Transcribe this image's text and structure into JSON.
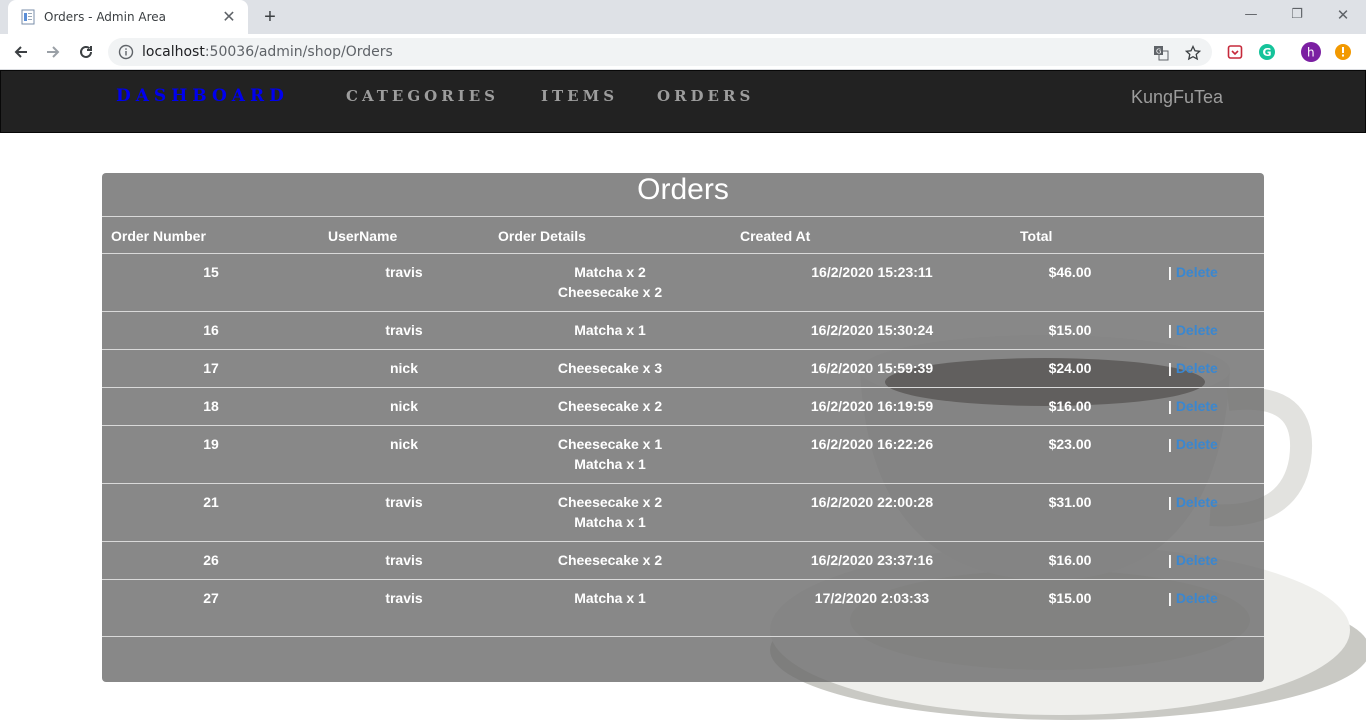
{
  "browser": {
    "tab_title": "Orders - Admin Area",
    "url_host": "localhost",
    "url_path": ":50036/admin/shop/Orders"
  },
  "nav": {
    "dashboard": "Dashboard",
    "categories": "Categories",
    "items": "Items",
    "orders": "Orders",
    "brand": "KungFuTea"
  },
  "panel": {
    "title": "Orders",
    "headers": {
      "order_number": "Order Number",
      "username": "UserName",
      "order_details": "Order Details",
      "created_at": "Created At",
      "total": "Total"
    },
    "delete_label": "Delete",
    "separator": "|",
    "rows": [
      {
        "num": "15",
        "user": "travis",
        "details": [
          "Matcha x 2",
          "Cheesecake x 2"
        ],
        "date": "16/2/2020 15:23:11",
        "total": "$46.00"
      },
      {
        "num": "16",
        "user": "travis",
        "details": [
          "Matcha x 1"
        ],
        "date": "16/2/2020 15:30:24",
        "total": "$15.00"
      },
      {
        "num": "17",
        "user": "nick",
        "details": [
          "Cheesecake x 3"
        ],
        "date": "16/2/2020 15:59:39",
        "total": "$24.00"
      },
      {
        "num": "18",
        "user": "nick",
        "details": [
          "Cheesecake x 2"
        ],
        "date": "16/2/2020 16:19:59",
        "total": "$16.00"
      },
      {
        "num": "19",
        "user": "nick",
        "details": [
          "Cheesecake x 1",
          "Matcha x 1"
        ],
        "date": "16/2/2020 16:22:26",
        "total": "$23.00"
      },
      {
        "num": "21",
        "user": "travis",
        "details": [
          "Cheesecake x 2",
          "Matcha x 1"
        ],
        "date": "16/2/2020 22:00:28",
        "total": "$31.00"
      },
      {
        "num": "26",
        "user": "travis",
        "details": [
          "Cheesecake x 2"
        ],
        "date": "16/2/2020 23:37:16",
        "total": "$16.00"
      },
      {
        "num": "27",
        "user": "travis",
        "details": [
          "Matcha x 1"
        ],
        "date": "17/2/2020 2:03:33",
        "total": "$15.00"
      }
    ]
  },
  "colors": {
    "navbar_bg": "#222222",
    "dashboard_link": "#0000ee",
    "delete_link": "#3a87d0",
    "panel_bg": "#6e6e6e"
  }
}
